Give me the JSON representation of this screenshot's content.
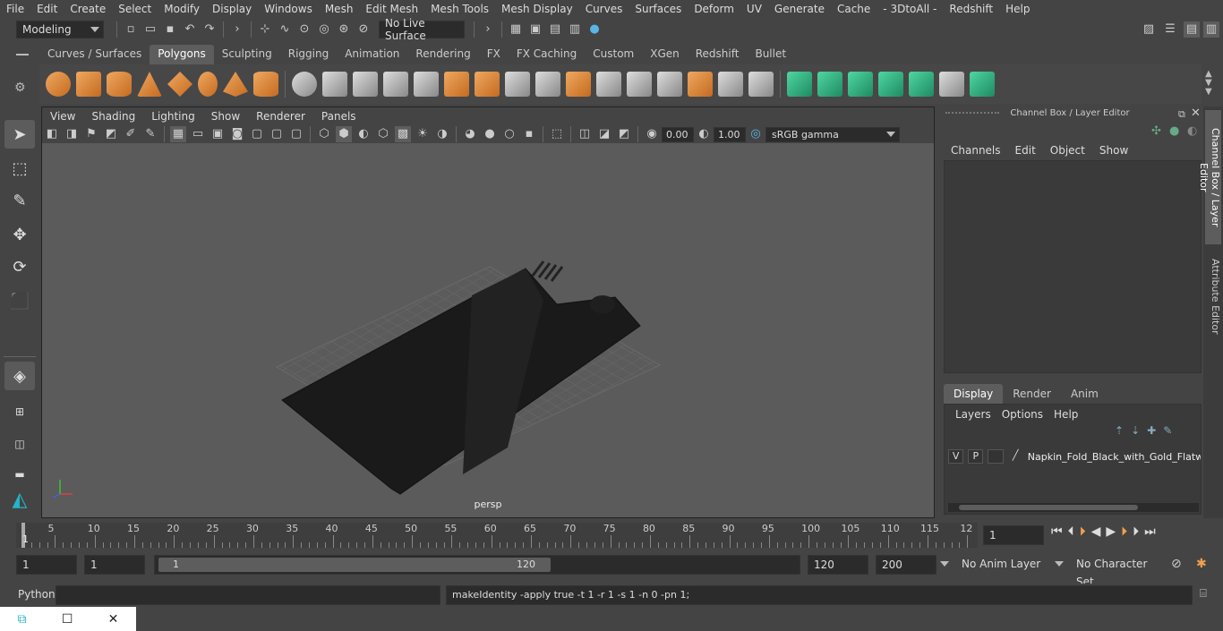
{
  "menubar": {
    "items": [
      "File",
      "Edit",
      "Create",
      "Select",
      "Modify",
      "Display",
      "Windows",
      "Mesh",
      "Edit Mesh",
      "Mesh Tools",
      "Mesh Display",
      "Curves",
      "Surfaces",
      "Deform",
      "UV",
      "Generate",
      "Cache",
      "- 3DtoAll -",
      "Redshift",
      "Help"
    ]
  },
  "statusline": {
    "mode": "Modeling",
    "live_surface": "No Live Surface"
  },
  "shelf": {
    "tabs": [
      "Curves / Surfaces",
      "Polygons",
      "Sculpting",
      "Rigging",
      "Animation",
      "Rendering",
      "FX",
      "FX Caching",
      "Custom",
      "XGen",
      "Redshift",
      "Bullet"
    ],
    "active_tab": "Polygons"
  },
  "viewport": {
    "menu": [
      "View",
      "Shading",
      "Lighting",
      "Show",
      "Renderer",
      "Panels"
    ],
    "exposure": "0.00",
    "gamma": "1.00",
    "color_space": "sRGB gamma",
    "camera_label": "persp"
  },
  "channelbox": {
    "title": "Channel Box / Layer Editor",
    "menu": [
      "Channels",
      "Edit",
      "Object",
      "Show"
    ],
    "tabs": [
      "Display",
      "Render",
      "Anim"
    ],
    "active_tab": "Display",
    "layer_menu": [
      "Layers",
      "Options",
      "Help"
    ],
    "layer": {
      "v": "V",
      "p": "P",
      "name": "Napkin_Fold_Black_with_Gold_Flatwa"
    }
  },
  "sidetabs": [
    "Channel Box / Layer Editor",
    "Attribute Editor"
  ],
  "timeline": {
    "ticks": [
      "5",
      "10",
      "15",
      "20",
      "25",
      "30",
      "35",
      "40",
      "45",
      "50",
      "55",
      "60",
      "65",
      "70",
      "75",
      "80",
      "85",
      "90",
      "95",
      "100",
      "105",
      "110",
      "115",
      "12"
    ],
    "start_marker": "1",
    "current_frame": "1"
  },
  "range": {
    "start": "1",
    "start2": "1",
    "slider_start": "1",
    "slider_end": "120",
    "end": "120",
    "max": "200",
    "anim_layer": "No Anim Layer",
    "char_set": "No Character Set"
  },
  "cmdline": {
    "lang": "Python",
    "output": "makeIdentity -apply true -t 1 -r 1 -s 1 -n 0 -pn 1;"
  }
}
